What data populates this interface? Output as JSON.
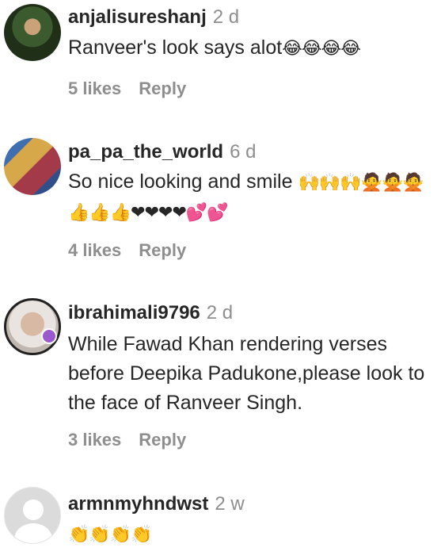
{
  "comments": [
    {
      "username": "anjalisureshanj",
      "time": "2 d",
      "text": "Ranveer's look says alot",
      "emoji": "😂😂😂😂",
      "likes": "5 likes",
      "reply": "Reply"
    },
    {
      "username": "pa_pa_the_world",
      "time": "6 d",
      "text": "So nice looking and smile",
      "emoji": "🙌🙌🙌🙅🙅🙅👍👍👍❤❤❤❤💕💕",
      "likes": "4 likes",
      "reply": "Reply"
    },
    {
      "username": "ibrahimali9796",
      "time": "2 d",
      "text": "While Fawad Khan rendering verses before Deepika Padukone,please look to the face of Ranveer Singh.",
      "likes": "3 likes",
      "reply": "Reply"
    },
    {
      "username": "armnmyhndwst",
      "time": "2 w",
      "emoji": "👏👏👏👏"
    }
  ],
  "colors": {
    "text": "#262626",
    "secondary": "#8e8e8e",
    "badge": "#9b59d0"
  }
}
